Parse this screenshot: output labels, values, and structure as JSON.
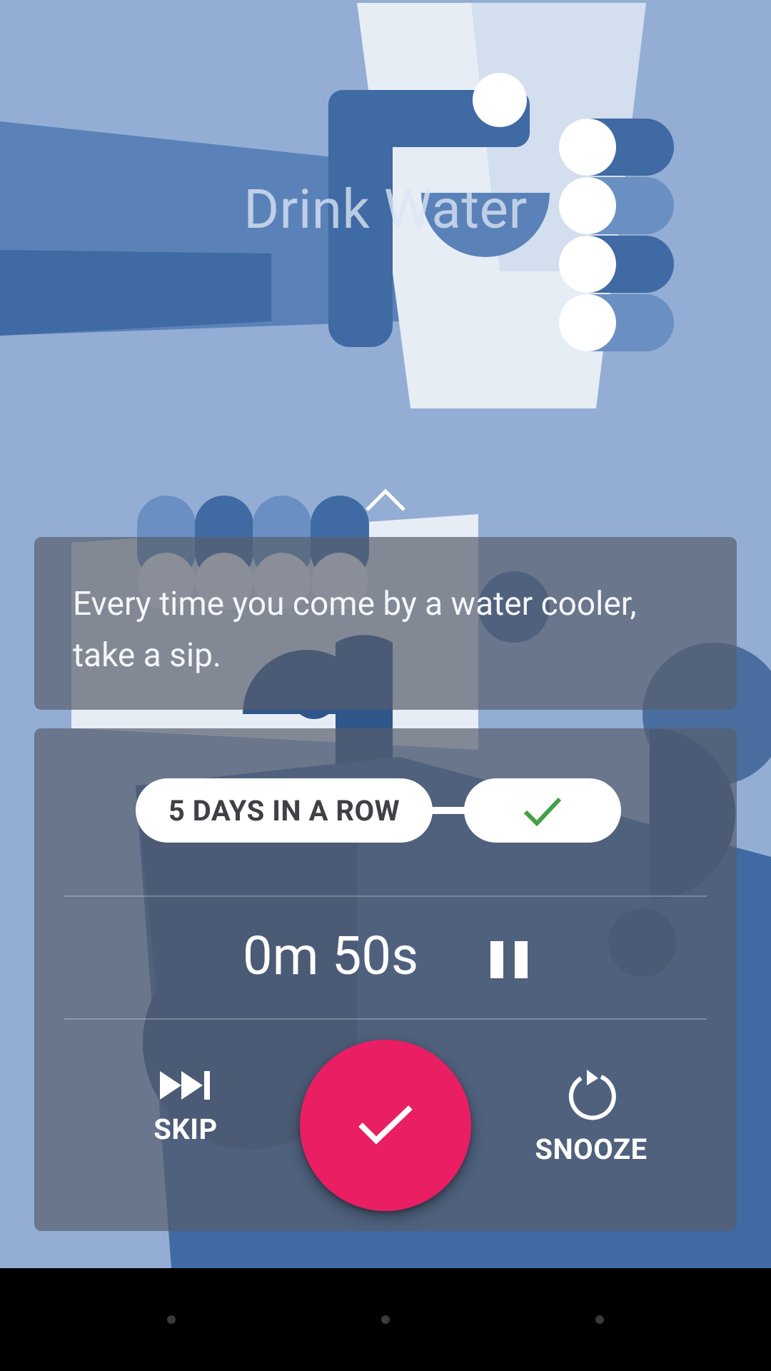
{
  "habit": {
    "title": "Drink Water",
    "tip": "Every time you come by a water cooler, take a sip."
  },
  "streak": {
    "label": "5 DAYS IN A ROW",
    "status_icon": "check-icon",
    "status_color": "#43a047"
  },
  "timer": {
    "value": "0m 50s",
    "control_icon": "pause-icon"
  },
  "actions": {
    "skip_label": "SKIP",
    "skip_icon": "skip-next-icon",
    "snooze_label": "SNOOZE",
    "snooze_icon": "snooze-icon",
    "complete_icon": "check-icon"
  },
  "colors": {
    "background": "#93add4",
    "accent": "#e91e63",
    "card": "#575e6c",
    "illustration_dark": "#3f6aa3"
  },
  "system_nav": {
    "items": [
      "back",
      "home",
      "recents"
    ]
  }
}
